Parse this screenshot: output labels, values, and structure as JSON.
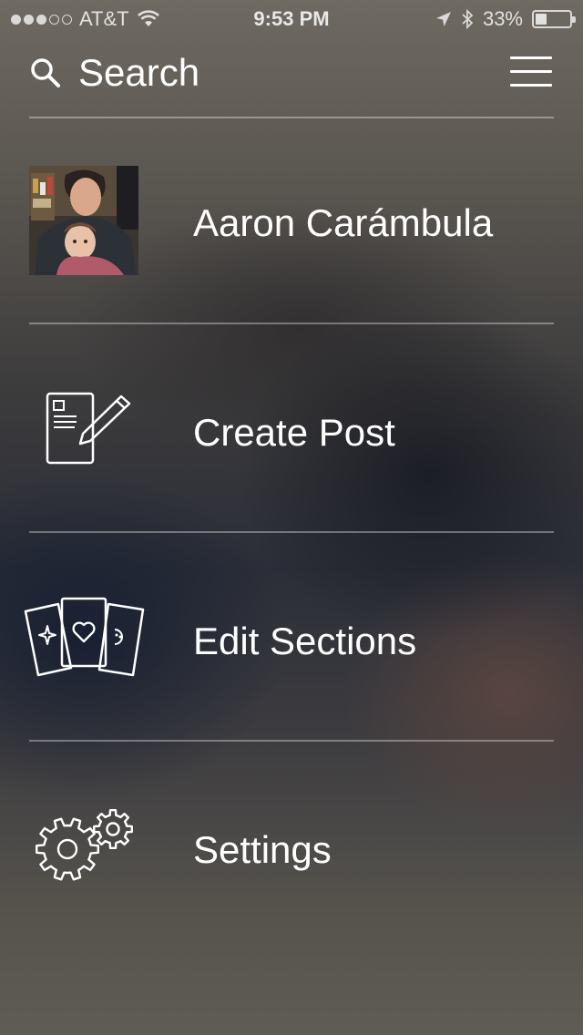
{
  "status_bar": {
    "carrier": "AT&T",
    "signal_bars_filled": 3,
    "signal_bars_total": 5,
    "time": "9:53 PM",
    "battery_percent": "33%",
    "battery_level": 0.33,
    "icons": [
      "wifi-icon",
      "location-arrow-icon",
      "bluetooth-icon",
      "battery-icon"
    ]
  },
  "header": {
    "search_label": "Search",
    "search_icon": "search-icon",
    "menu_icon": "hamburger-menu-icon"
  },
  "menu": {
    "items": [
      {
        "label": "Aaron Carámbula",
        "icon": "avatar"
      },
      {
        "label": "Create Post",
        "icon": "create-post-icon"
      },
      {
        "label": "Edit Sections",
        "icon": "cards-icon"
      },
      {
        "label": "Settings",
        "icon": "gears-icon"
      }
    ]
  }
}
